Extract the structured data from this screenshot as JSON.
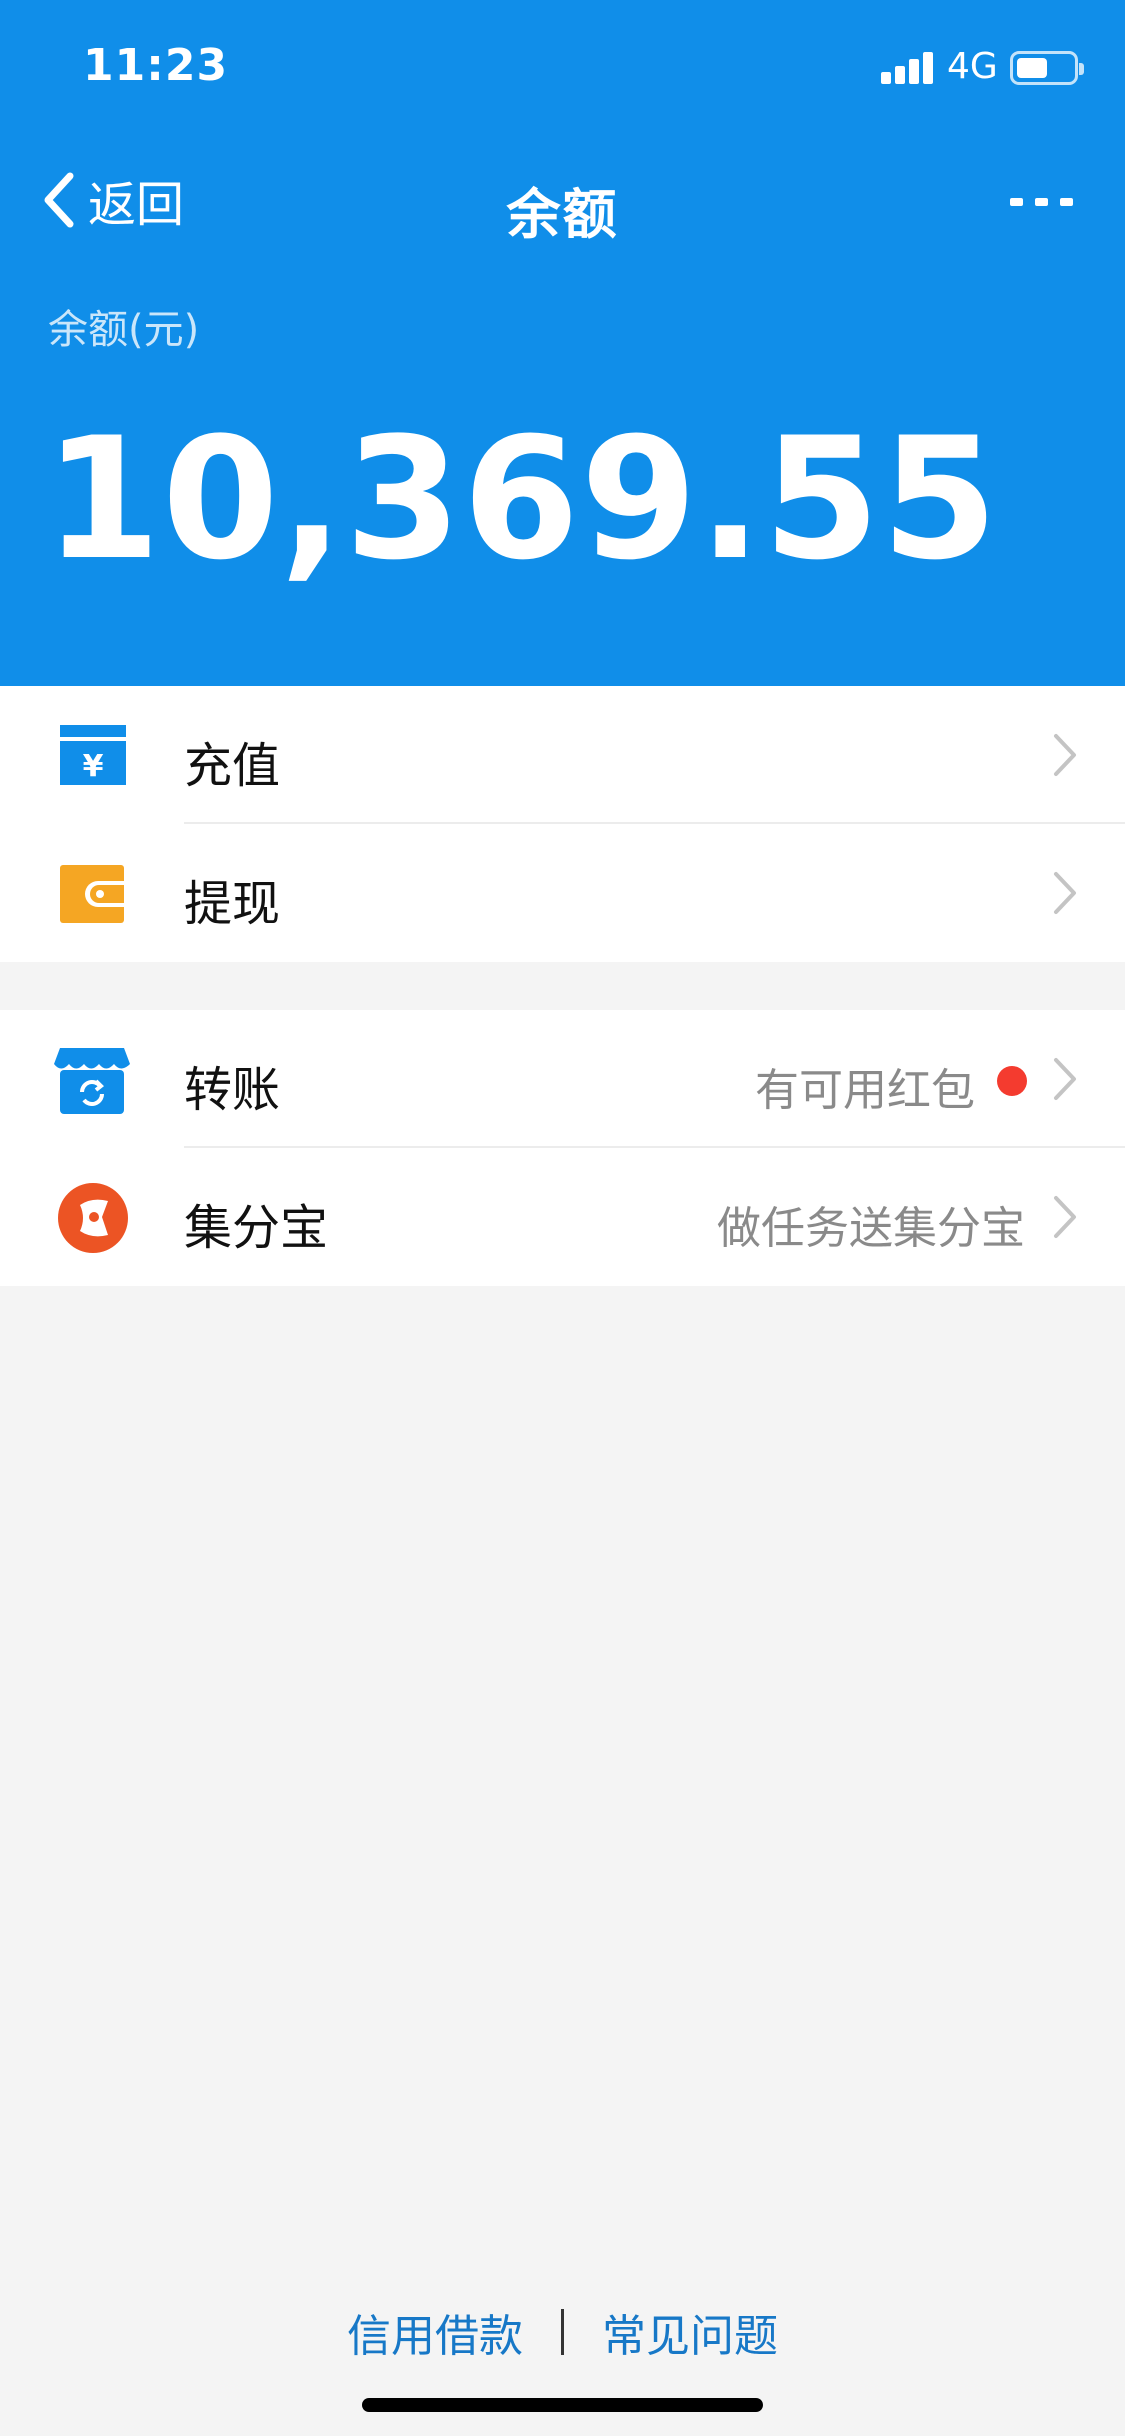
{
  "status_bar": {
    "time": "11:23",
    "network": "4G"
  },
  "nav": {
    "back_label": "返回",
    "title": "余额"
  },
  "balance": {
    "label": "余额(元)",
    "amount": "10,369.55"
  },
  "groups": [
    {
      "items": [
        {
          "label": "充值",
          "icon": "recharge-yuan-icon"
        },
        {
          "label": "提现",
          "icon": "wallet-withdraw-icon"
        }
      ]
    },
    {
      "items": [
        {
          "label": "转账",
          "hint": "有可用红包",
          "icon": "transfer-icon",
          "badge": true
        },
        {
          "label": "集分宝",
          "hint": "做任务送集分宝",
          "icon": "jifenbao-icon"
        }
      ]
    }
  ],
  "footer": {
    "link_credit": "信用借款",
    "link_faq": "常见问题"
  },
  "colors": {
    "brand_blue": "#108ee9",
    "badge_red": "#f43b2f",
    "link_blue": "#1778c7",
    "withdraw_orange": "#f5a623",
    "jifenbao_orange": "#ec5424"
  }
}
